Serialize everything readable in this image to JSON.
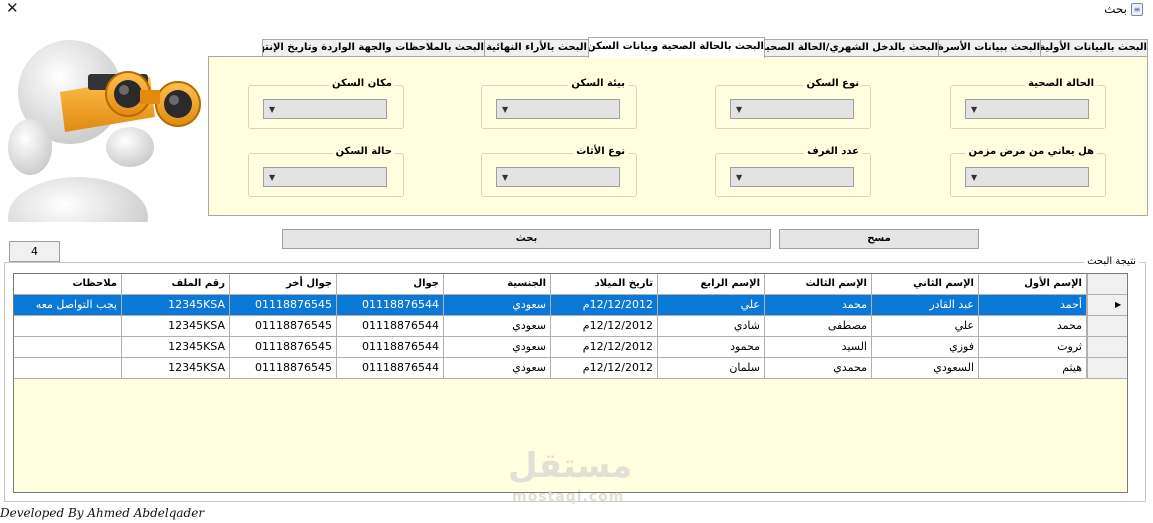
{
  "window": {
    "title": "بحث",
    "close_glyph": "✕",
    "icon": "document-icon"
  },
  "tabs": [
    {
      "label": "البحث بالبيانات الأولية",
      "active": false
    },
    {
      "label": "البحث ببيانات الأسرة",
      "active": false
    },
    {
      "label": "البحث بالدخل الشهري/الحالة الصحية",
      "active": false
    },
    {
      "label": "البحث بالحالة الصحية وبيانات السكن",
      "active": true
    },
    {
      "label": "البحث بالأراء النهائية",
      "active": false
    },
    {
      "label": "البحث بالملاحظات والجهة الواردة وتاريخ الإنتهاء",
      "active": false
    }
  ],
  "filters": {
    "health_status": {
      "label": "الحالة الصحية",
      "value": ""
    },
    "housing_type": {
      "label": "نوع السكن",
      "value": ""
    },
    "housing_environment": {
      "label": "بيئة السكن",
      "value": ""
    },
    "housing_location": {
      "label": "مكان السكن",
      "value": ""
    },
    "chronic_disease": {
      "label": "هل يعاني من مرض مزمن",
      "value": ""
    },
    "rooms_count": {
      "label": "عدد الغرف",
      "value": ""
    },
    "furniture_type": {
      "label": "نوع الأثاث",
      "value": ""
    },
    "housing_condition": {
      "label": "حالة السكن",
      "value": ""
    }
  },
  "result_count": "4",
  "buttons": {
    "search": "بحث",
    "clear": "مسح"
  },
  "results": {
    "label": "نتيجة البحث",
    "columns": [
      "الإسم الأول",
      "الإسم الثاني",
      "الإسم الثالث",
      "الإسم الرابع",
      "تاريخ الميلاد",
      "الجنسية",
      "جوال",
      "جوال أخر",
      "رقم الملف",
      "ملاحظات"
    ],
    "rows": [
      [
        "أحمد",
        "عبد القادر",
        "محمد",
        "علي",
        "12/12/2012م",
        "سعودي",
        "01118876544",
        "01118876545",
        "12345KSA",
        "يجب التواصل معه"
      ],
      [
        "محمد",
        "علي",
        "مصطفى",
        "شادي",
        "12/12/2012م",
        "سعودي",
        "01118876544",
        "01118876545",
        "12345KSA",
        ""
      ],
      [
        "ثروت",
        "فوزي",
        "السيد",
        "محمود",
        "12/12/2012م",
        "سعودي",
        "01118876544",
        "01118876545",
        "12345KSA",
        ""
      ],
      [
        "هيثم",
        "السعودي",
        "محمدي",
        "سلمان",
        "12/12/2012م",
        "سعودي",
        "01118876544",
        "01118876545",
        "12345KSA",
        ""
      ]
    ],
    "selected_row": 0
  },
  "watermark": {
    "arabic": "مستقل",
    "latin": "mostaqi.com"
  },
  "footer": "Developed By Ahmed Abdelqader",
  "colors": {
    "panel_bg": "#ffffe0",
    "selection": "#0a78d7",
    "mascot_orange": "#f5a623"
  }
}
